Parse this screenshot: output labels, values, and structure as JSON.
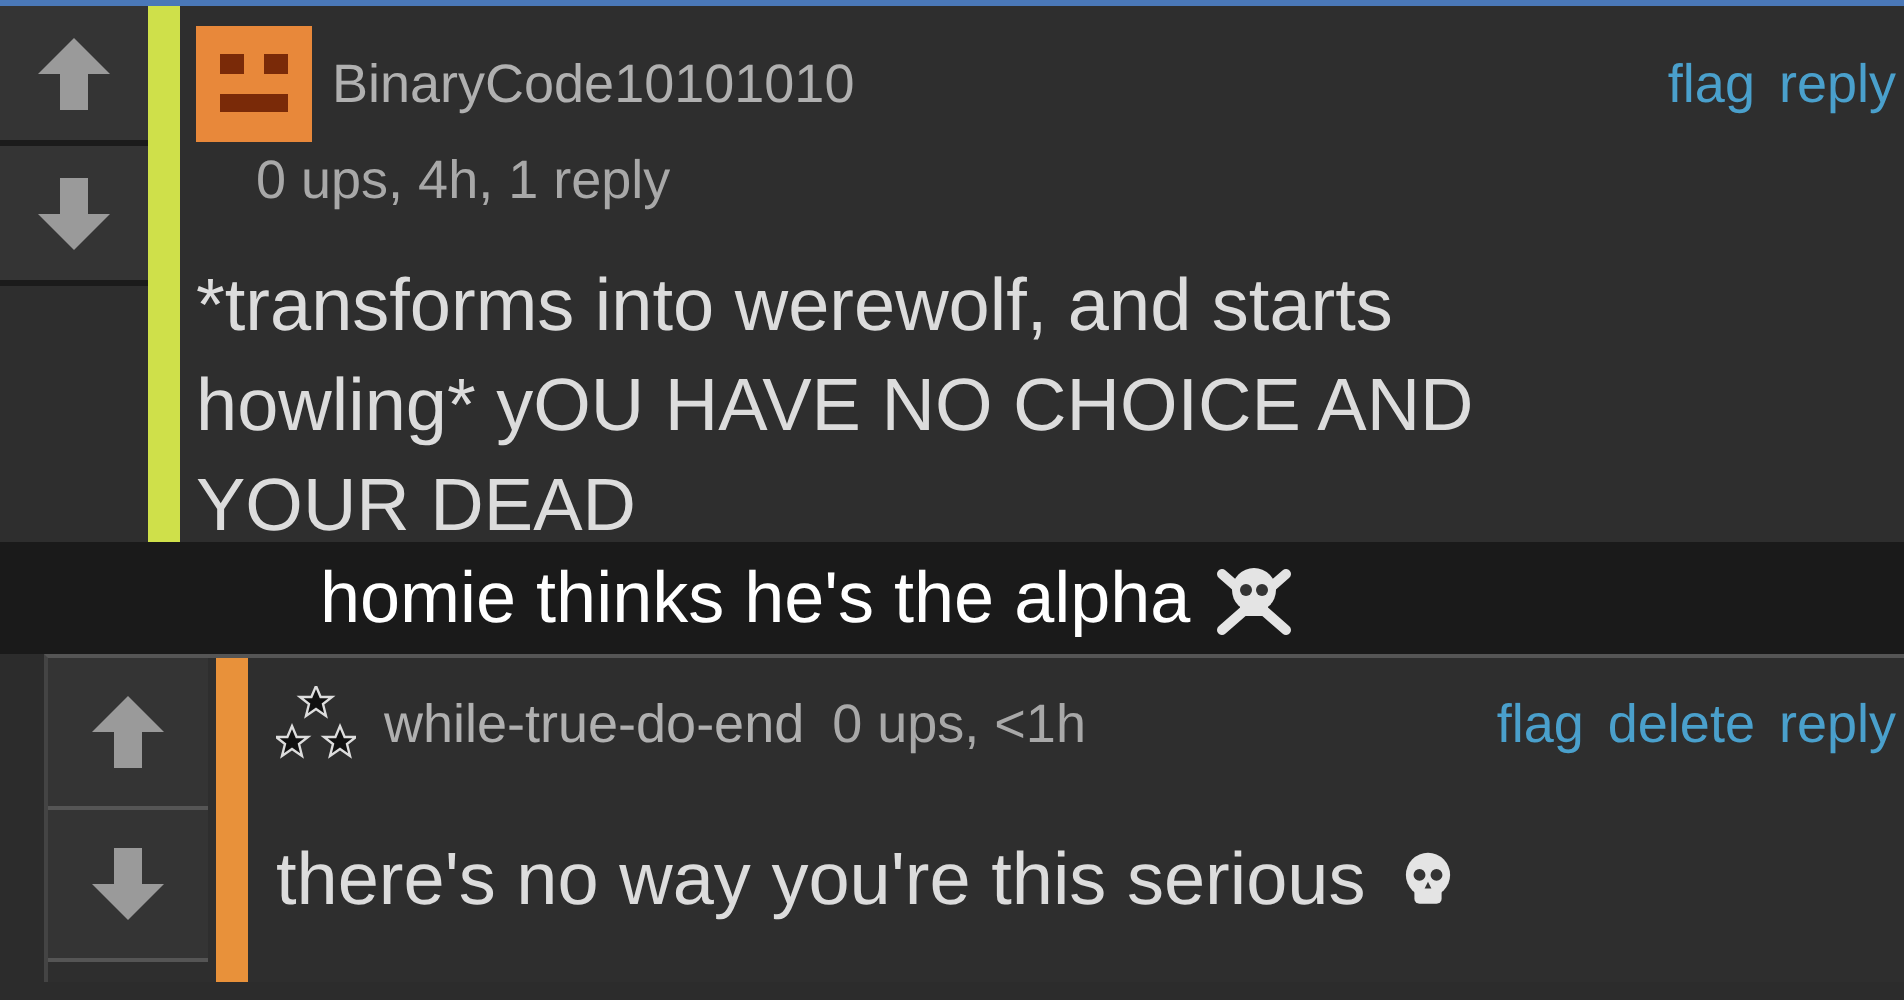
{
  "comments": [
    {
      "kind": "top",
      "color": "#cfe04a",
      "username": "BinaryCode10101010",
      "meta": "0 ups, 4h, 1 reply",
      "actions": [
        "flag",
        "reply"
      ],
      "body": "*transforms into werewolf, and starts howling* yOU HAVE NO CHOICE AND YOUR DEAD"
    },
    {
      "kind": "reply",
      "color": "#e8913a",
      "username": "while-true-do-end",
      "meta": "0 ups, <1h",
      "actions": [
        "flag",
        "delete",
        "reply"
      ],
      "body": "there's no way you're this serious"
    }
  ],
  "caption": {
    "text": "homie thinks he's the alpha"
  }
}
